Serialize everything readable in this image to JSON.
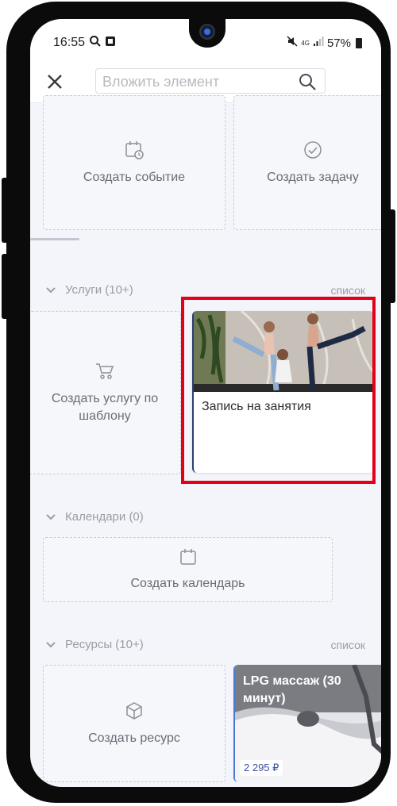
{
  "status_bar": {
    "time": "16:55",
    "battery": "57%",
    "network": "4G"
  },
  "toolbar": {
    "search_placeholder": "Вложить элемент"
  },
  "quick_actions": [
    {
      "label": "Создать событие",
      "icon": "calendar-clock-icon"
    },
    {
      "label": "Создать задачу",
      "icon": "check-circle-icon"
    }
  ],
  "services": {
    "header": "Услуги (10+)",
    "link": "список",
    "create_label": "Создать услугу по шаблону",
    "card_title": "Запись на занятия"
  },
  "calendars": {
    "header": "Календари (0)",
    "create_label": "Создать календарь"
  },
  "resources": {
    "header": "Ресурсы (10+)",
    "link": "список",
    "create_label": "Создать ресурс",
    "card_title": "LPG массаж (30 минут)",
    "card_price": "2 295 ₽"
  },
  "colors": {
    "highlight": "#e5001a",
    "accent": "#2c3e73",
    "price": "#3b4fa0"
  }
}
